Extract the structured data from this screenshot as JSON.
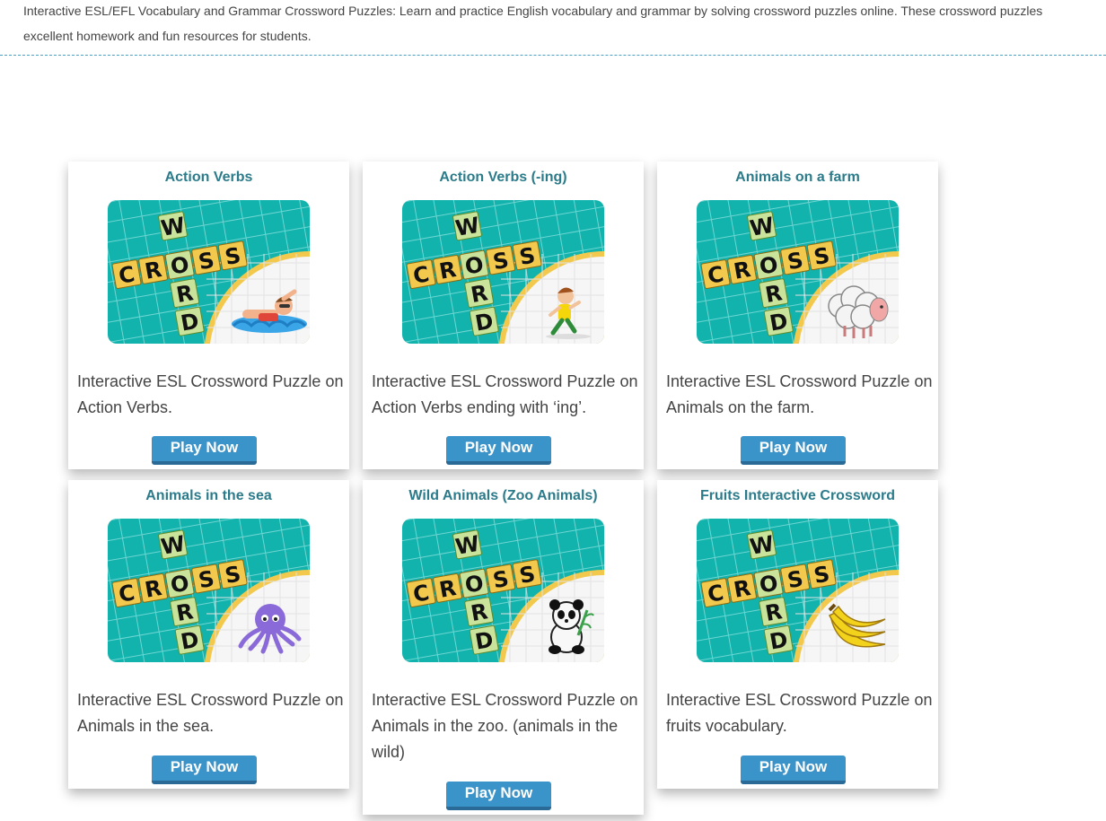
{
  "intro": {
    "line1": "Interactive ESL/EFL Vocabulary and Grammar Crossword Puzzles: Learn and practice English vocabulary and grammar by solving crossword puzzles online. These crossword puzzles",
    "line2": "excellent homework and fun resources for students."
  },
  "thumb_text": {
    "cross": [
      "C",
      "R",
      "O",
      "S",
      "S"
    ],
    "word": [
      "W",
      "O",
      "R",
      "D"
    ]
  },
  "colors": {
    "title": "#2c7b8a",
    "button": "#3a93c9",
    "teal": "#12b2ad",
    "tile_yellow": "#f2c94c",
    "tile_green": "#c9e39a"
  },
  "cards": [
    {
      "title": "Action Verbs",
      "desc_line1": "Interactive ESL Crossword Puzzle on",
      "desc_line2": "Action Verbs.",
      "desc_line3": "",
      "button": "Play Now",
      "picture": "swimmer-icon"
    },
    {
      "title": "Action Verbs (-ing)",
      "desc_line1": "Interactive ESL Crossword Puzzle on",
      "desc_line2": "Action Verbs ending with ‘ing’.",
      "desc_line3": "",
      "button": "Play Now",
      "picture": "running-boy-icon"
    },
    {
      "title": "Animals on a farm",
      "desc_line1": "Interactive ESL Crossword Puzzle on",
      "desc_line2": "Animals on the farm.",
      "desc_line3": "",
      "button": "Play Now",
      "picture": "sheep-icon"
    },
    {
      "title": "Animals in the sea",
      "desc_line1": "Interactive ESL Crossword Puzzle on",
      "desc_line2": "Animals in the sea.",
      "desc_line3": "",
      "button": "Play Now",
      "picture": "octopus-icon"
    },
    {
      "title": "Wild Animals (Zoo Animals)",
      "desc_line1": "Interactive ESL Crossword Puzzle on",
      "desc_line2": "Animals in the zoo. (animals in the",
      "desc_line3": "wild)",
      "button": "Play Now",
      "picture": "panda-icon"
    },
    {
      "title": "Fruits Interactive Crossword",
      "desc_line1": "Interactive ESL Crossword Puzzle on",
      "desc_line2": "fruits vocabulary.",
      "desc_line3": "",
      "button": "Play Now",
      "picture": "bananas-icon"
    }
  ]
}
